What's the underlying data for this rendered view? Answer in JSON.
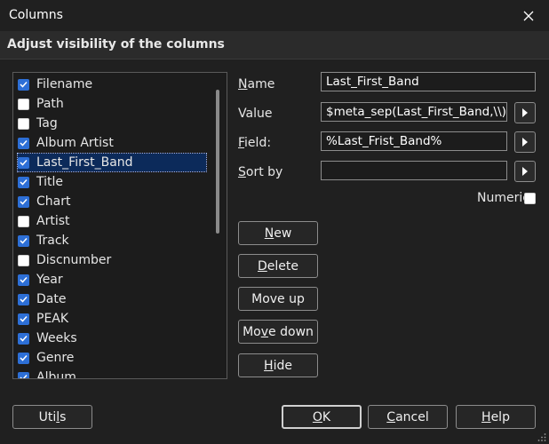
{
  "window": {
    "title": "Columns"
  },
  "header": {
    "text": "Adjust visibility of the columns"
  },
  "columns": [
    {
      "label": "Filename",
      "checked": true
    },
    {
      "label": "Path",
      "checked": false
    },
    {
      "label": "Tag",
      "checked": false
    },
    {
      "label": "Album Artist",
      "checked": true
    },
    {
      "label": "Last_First_Band",
      "checked": true,
      "selected": true
    },
    {
      "label": "Title",
      "checked": true
    },
    {
      "label": "Chart",
      "checked": true
    },
    {
      "label": "Artist",
      "checked": false
    },
    {
      "label": "Track",
      "checked": true
    },
    {
      "label": "Discnumber",
      "checked": false
    },
    {
      "label": "Year",
      "checked": true
    },
    {
      "label": "Date",
      "checked": true
    },
    {
      "label": "PEAK",
      "checked": true
    },
    {
      "label": "Weeks",
      "checked": true
    },
    {
      "label": "Genre",
      "checked": true
    },
    {
      "label": "Album",
      "checked": true
    }
  ],
  "form": {
    "name_label": "Name",
    "name_value": "Last_First_Band",
    "value_label": "Value",
    "value_value": "$meta_sep(Last_First_Band,\\\\)",
    "field_label": "Field:",
    "field_value": "%Last_Frist_Band%",
    "sortby_label": "Sort by",
    "sortby_value": "",
    "numeric_label": "Numeric"
  },
  "buttons": {
    "new": "New",
    "delete": "Delete",
    "move_up": "Move up",
    "move_down": "Move down",
    "hide": "Hide",
    "utils": "Utils",
    "ok": "OK",
    "cancel": "Cancel",
    "help": "Help"
  },
  "colors": {
    "accent": "#2d6fd6",
    "background": "#202020"
  }
}
